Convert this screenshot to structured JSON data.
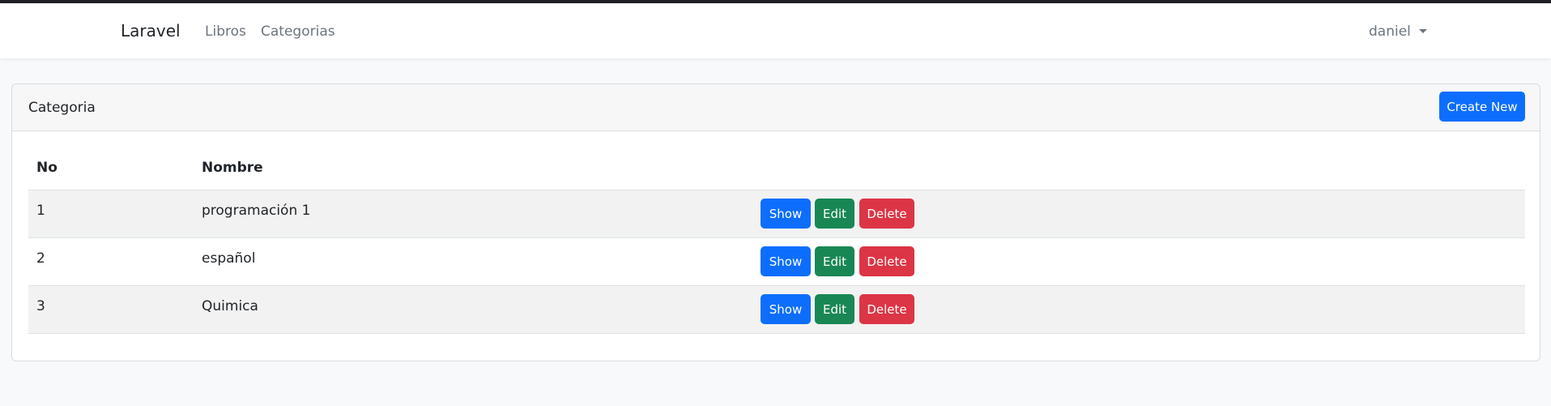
{
  "navbar": {
    "brand": "Laravel",
    "links": [
      "Libros",
      "Categorias"
    ],
    "user": "daniel"
  },
  "card": {
    "title": "Categoria",
    "create_label": "Create New"
  },
  "table": {
    "columns": [
      "No",
      "Nombre"
    ],
    "rows": [
      {
        "no": "1",
        "nombre": "programación 1"
      },
      {
        "no": "2",
        "nombre": "español"
      },
      {
        "no": "3",
        "nombre": "Quimica"
      }
    ],
    "actions": {
      "show": "Show",
      "edit": "Edit",
      "delete": "Delete"
    }
  },
  "colors": {
    "primary": "#0d6efd",
    "success": "#198754",
    "danger": "#dc3545",
    "background": "#f8f9fa"
  }
}
